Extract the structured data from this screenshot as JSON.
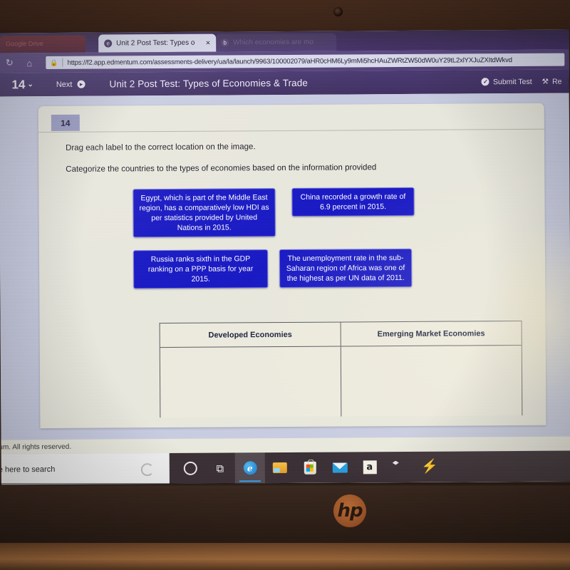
{
  "device": {
    "brand_logo": "hp",
    "webcam": "webcam-lens"
  },
  "browser": {
    "ghost_tab_title": "Google Drive",
    "tabs": [
      {
        "title": "Unit 2 Post Test: Types o",
        "favicon": "e",
        "close": "×",
        "active": true
      },
      {
        "title": "Which economies are mo",
        "favicon": "b",
        "close": "",
        "active": false
      }
    ],
    "nav": {
      "reload_icon": "↻",
      "home_icon": "⌂"
    },
    "address_bar": {
      "lock_icon": "🔒",
      "url": "https://f2.app.edmentum.com/assessments-delivery/ua/la/launch/9963/100002079/aHR0cHM6Ly9mMi5hcHAuZWRtZW50dW0uY29tL2xlYXJuZXItdWkvd"
    }
  },
  "appbar": {
    "question_number": "14",
    "caret": "⌄",
    "next_label": "Next",
    "next_icon": "▶",
    "title": "Unit 2 Post Test: Types of Economies & Trade",
    "submit_label": "Submit Test",
    "submit_icon": "✓",
    "tools_label": "Re",
    "tools_icon": "⚒"
  },
  "question": {
    "badge": "14",
    "instruction": "Drag each label to the correct location on the image.",
    "prompt": "Categorize the countries to the types of economies based on the information provided",
    "drag_labels": [
      "Egypt, which is part of the Middle East region, has a comparatively low HDI as per statistics provided by United Nations in 2015.",
      "China recorded a growth rate of 6.9 percent in 2015.",
      "Russia ranks sixth in the GDP ranking on a PPP basis for year 2015.",
      "The unemployment rate in the sub-Saharan region of Africa was one of the highest as per UN data of 2011."
    ],
    "drop_columns": [
      {
        "header": "Developed Economies",
        "items": []
      },
      {
        "header": "Emerging Market Economies",
        "items": []
      }
    ]
  },
  "footer": {
    "copyright": "tum. All rights reserved."
  },
  "taskbar": {
    "search_placeholder": "e here to search",
    "icons": [
      "cortana-icon",
      "task-view-icon",
      "edge-icon",
      "file-explorer-icon",
      "microsoft-store-icon",
      "mail-icon",
      "amazon-icon",
      "dropbox-icon",
      "lightning-icon"
    ],
    "edge_glyph": "e",
    "taskview_glyph": "⧉",
    "amazon_glyph": "a",
    "bolt_glyph": "⚡"
  },
  "colors": {
    "browser_chrome": "#55427a",
    "app_header": "#413162",
    "label_fill": "#1a1ac4",
    "page_bg": "#e8e7dd",
    "badge": "#9a9cc4"
  }
}
